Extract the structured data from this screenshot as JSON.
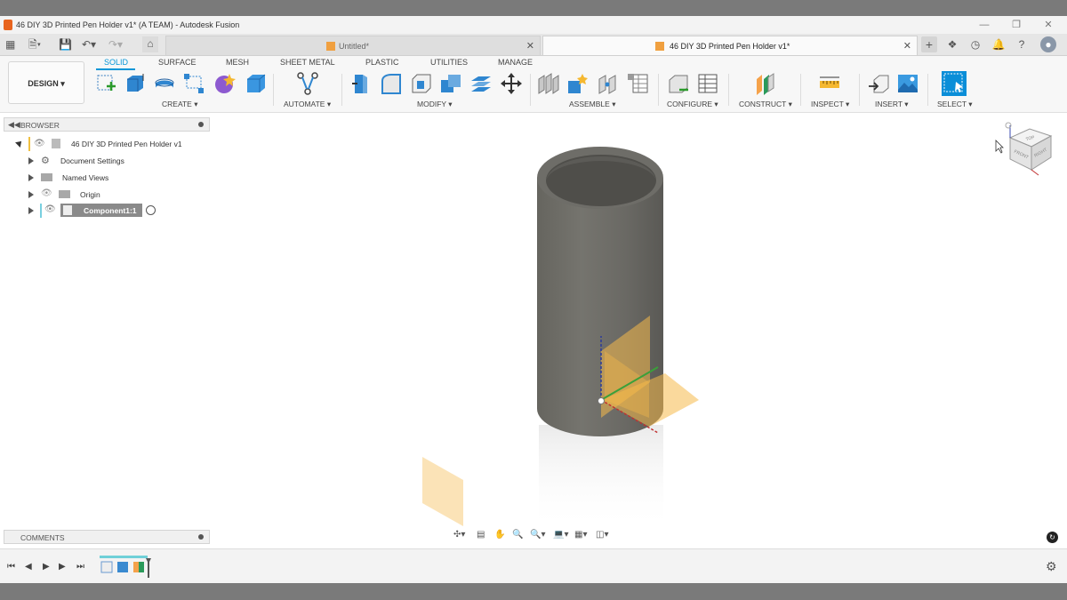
{
  "window": {
    "title": "46 DIY 3D Printed Pen Holder v1* (A TEAM) - Autodesk Fusion"
  },
  "tabs": [
    {
      "label": "Untitled*"
    },
    {
      "label": "46 DIY 3D Printed Pen Holder v1*"
    }
  ],
  "workspace": {
    "label": "DESIGN"
  },
  "ribbon_tabs": [
    "SOLID",
    "SURFACE",
    "MESH",
    "SHEET METAL",
    "PLASTIC",
    "UTILITIES",
    "MANAGE"
  ],
  "tool_groups": [
    "CREATE",
    "AUTOMATE",
    "MODIFY",
    "ASSEMBLE",
    "CONFIGURE",
    "CONSTRUCT",
    "INSPECT",
    "INSERT",
    "SELECT"
  ],
  "browser": {
    "title": "BROWSER",
    "root": "46 DIY 3D Printed Pen Holder v1",
    "items": [
      "Document Settings",
      "Named Views",
      "Origin",
      "Component1:1"
    ]
  },
  "comments": {
    "title": "COMMENTS"
  },
  "viewcube": {
    "faces": [
      "TOP",
      "FRONT",
      "RIGHT"
    ]
  },
  "colors": {
    "accent": "#0696d7",
    "cylinder": "#6b6b66",
    "origin_plane": "#f5b94a"
  }
}
